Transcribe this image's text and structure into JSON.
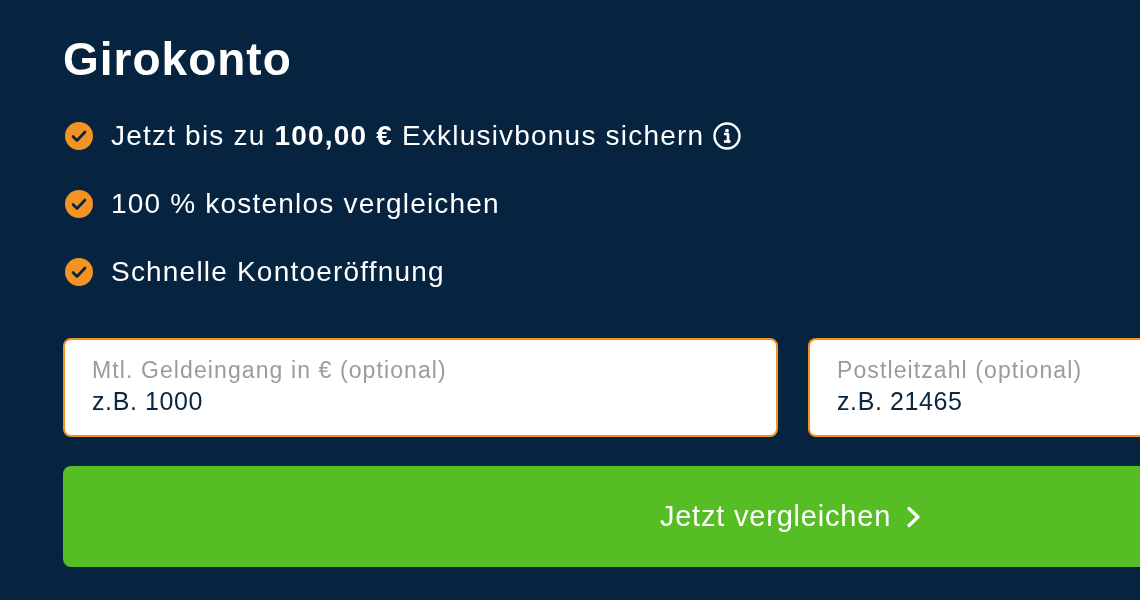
{
  "title": "Girokonto",
  "benefits": [
    {
      "text": "Jetzt bis zu **100,00 €** Exklusivbonus sichern",
      "info": true
    },
    {
      "text": "100 % kostenlos vergleichen",
      "info": false
    },
    {
      "text": "Schnelle Kontoeröffnung",
      "info": false
    }
  ],
  "fields": [
    {
      "label": "Mtl. Geldeingang in € (optional)",
      "placeholder": "z.B. 1000"
    },
    {
      "label": "Postleitzahl (optional)",
      "placeholder": "z.B. 21465"
    }
  ],
  "submit_button": {
    "label": "Jetzt vergleichen"
  }
}
